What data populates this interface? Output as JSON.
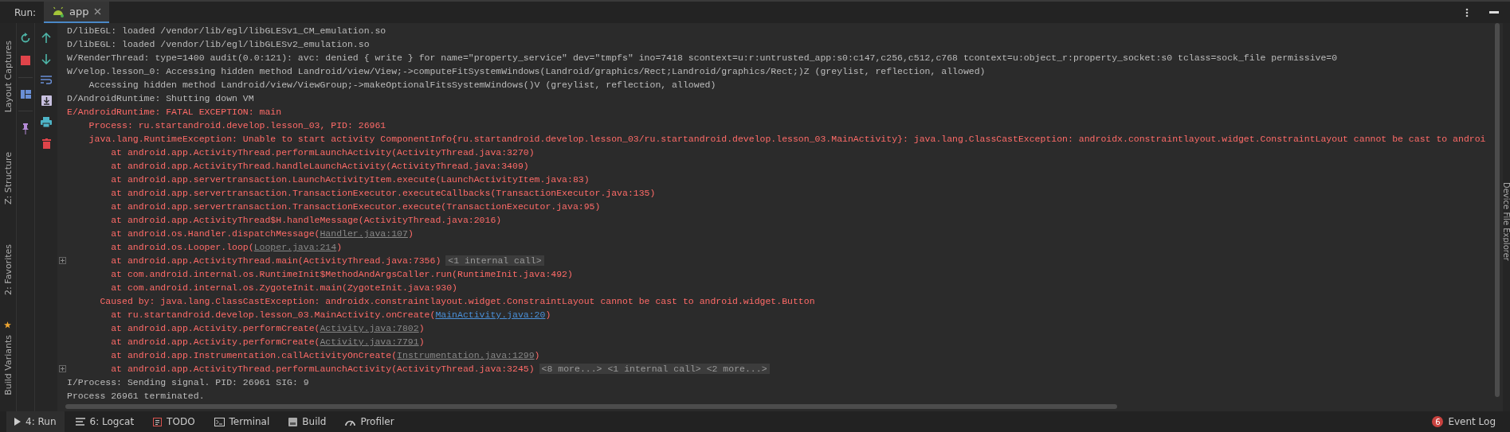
{
  "run_bar": {
    "label": "Run:",
    "tabs": [
      {
        "label": "app",
        "selected": true
      }
    ]
  },
  "left_strip": [
    "Layout Captures",
    "Z: Structure",
    "2: Favorites",
    "Build Variants"
  ],
  "right_strip": [
    "Device File Explorer"
  ],
  "log": [
    {
      "kind": "info",
      "collapsible": false,
      "parts": [
        {
          "kind": "text",
          "text": "D/libEGL: loaded /vendor/lib/egl/libGLESv1_CM_emulation.so"
        }
      ]
    },
    {
      "kind": "info",
      "collapsible": false,
      "parts": [
        {
          "kind": "text",
          "text": "D/libEGL: loaded /vendor/lib/egl/libGLESv2_emulation.so"
        }
      ]
    },
    {
      "kind": "info",
      "collapsible": false,
      "parts": [
        {
          "kind": "text",
          "text": "W/RenderThread: type=1400 audit(0.0:121): avc: denied { write } for name=\"property_service\" dev=\"tmpfs\" ino=7418 scontext=u:r:untrusted_app:s0:c147,c256,c512,c768 tcontext=u:object_r:property_socket:s0 tclass=sock_file permissive=0"
        }
      ]
    },
    {
      "kind": "info",
      "collapsible": false,
      "parts": [
        {
          "kind": "text",
          "text": "W/velop.lesson_0: Accessing hidden method Landroid/view/View;->computeFitSystemWindows(Landroid/graphics/Rect;Landroid/graphics/Rect;)Z (greylist, reflection, allowed)"
        }
      ]
    },
    {
      "kind": "info",
      "collapsible": false,
      "parts": [
        {
          "kind": "text",
          "text": "    Accessing hidden method Landroid/view/ViewGroup;->makeOptionalFitsSystemWindows()V (greylist, reflection, allowed)"
        }
      ]
    },
    {
      "kind": "info",
      "collapsible": false,
      "parts": [
        {
          "kind": "text",
          "text": "D/AndroidRuntime: Shutting down VM"
        }
      ]
    },
    {
      "kind": "error",
      "collapsible": false,
      "parts": [
        {
          "kind": "text",
          "text": "E/AndroidRuntime: FATAL EXCEPTION: main"
        }
      ]
    },
    {
      "kind": "error",
      "collapsible": false,
      "parts": [
        {
          "kind": "text",
          "text": "    Process: ru.startandroid.develop.lesson_03, PID: 26961"
        }
      ]
    },
    {
      "kind": "error",
      "collapsible": false,
      "parts": [
        {
          "kind": "text",
          "text": "    java.lang.RuntimeException: Unable to start activity ComponentInfo{ru.startandroid.develop.lesson_03/ru.startandroid.develop.lesson_03.MainActivity}: java.lang.ClassCastException: androidx.constraintlayout.widget.ConstraintLayout cannot be cast to androi"
        }
      ]
    },
    {
      "kind": "error",
      "collapsible": false,
      "parts": [
        {
          "kind": "text",
          "text": "        at android.app.ActivityThread.performLaunchActivity(ActivityThread.java:3270)"
        }
      ]
    },
    {
      "kind": "error",
      "collapsible": false,
      "parts": [
        {
          "kind": "text",
          "text": "        at android.app.ActivityThread.handleLaunchActivity(ActivityThread.java:3409)"
        }
      ]
    },
    {
      "kind": "error",
      "collapsible": false,
      "parts": [
        {
          "kind": "text",
          "text": "        at android.app.servertransaction.LaunchActivityItem.execute(LaunchActivityItem.java:83)"
        }
      ]
    },
    {
      "kind": "error",
      "collapsible": false,
      "parts": [
        {
          "kind": "text",
          "text": "        at android.app.servertransaction.TransactionExecutor.executeCallbacks(TransactionExecutor.java:135)"
        }
      ]
    },
    {
      "kind": "error",
      "collapsible": false,
      "parts": [
        {
          "kind": "text",
          "text": "        at android.app.servertransaction.TransactionExecutor.execute(TransactionExecutor.java:95)"
        }
      ]
    },
    {
      "kind": "error",
      "collapsible": false,
      "parts": [
        {
          "kind": "text",
          "text": "        at android.app.ActivityThread$H.handleMessage(ActivityThread.java:2016)"
        }
      ]
    },
    {
      "kind": "error",
      "collapsible": false,
      "parts": [
        {
          "kind": "text",
          "text": "        at android.os.Handler.dispatchMessage("
        },
        {
          "kind": "library_link",
          "text": "Handler.java:107"
        },
        {
          "kind": "text",
          "text": ")"
        }
      ]
    },
    {
      "kind": "error",
      "collapsible": false,
      "parts": [
        {
          "kind": "text",
          "text": "        at android.os.Looper.loop("
        },
        {
          "kind": "library_link",
          "text": "Looper.java:214"
        },
        {
          "kind": "text",
          "text": ")"
        }
      ]
    },
    {
      "kind": "error",
      "collapsible": true,
      "parts": [
        {
          "kind": "text",
          "text": "        at android.app.ActivityThread.main(ActivityThread.java:7356)"
        },
        {
          "kind": "folded",
          "text": "<1 internal call>"
        }
      ]
    },
    {
      "kind": "error",
      "collapsible": false,
      "parts": [
        {
          "kind": "text",
          "text": "        at com.android.internal.os.RuntimeInit$MethodAndArgsCaller.run(RuntimeInit.java:492)"
        }
      ]
    },
    {
      "kind": "error",
      "collapsible": false,
      "parts": [
        {
          "kind": "text",
          "text": "        at com.android.internal.os.ZygoteInit.main(ZygoteInit.java:930)"
        }
      ]
    },
    {
      "kind": "error",
      "collapsible": false,
      "parts": [
        {
          "kind": "text",
          "text": "      Caused by: java.lang.ClassCastException: androidx.constraintlayout.widget.ConstraintLayout cannot be cast to android.widget.Button"
        }
      ]
    },
    {
      "kind": "error",
      "collapsible": false,
      "parts": [
        {
          "kind": "text",
          "text": "        at ru.startandroid.develop.lesson_03.MainActivity.onCreate("
        },
        {
          "kind": "project_link",
          "text": "MainActivity.java:20"
        },
        {
          "kind": "text",
          "text": ")"
        }
      ]
    },
    {
      "kind": "error",
      "collapsible": false,
      "parts": [
        {
          "kind": "text",
          "text": "        at android.app.Activity.performCreate("
        },
        {
          "kind": "library_link",
          "text": "Activity.java:7802"
        },
        {
          "kind": "text",
          "text": ")"
        }
      ]
    },
    {
      "kind": "error",
      "collapsible": false,
      "parts": [
        {
          "kind": "text",
          "text": "        at android.app.Activity.performCreate("
        },
        {
          "kind": "library_link",
          "text": "Activity.java:7791"
        },
        {
          "kind": "text",
          "text": ")"
        }
      ]
    },
    {
      "kind": "error",
      "collapsible": false,
      "parts": [
        {
          "kind": "text",
          "text": "        at android.app.Instrumentation.callActivityOnCreate("
        },
        {
          "kind": "library_link",
          "text": "Instrumentation.java:1299"
        },
        {
          "kind": "text",
          "text": ")"
        }
      ]
    },
    {
      "kind": "error",
      "collapsible": true,
      "parts": [
        {
          "kind": "text",
          "text": "        at android.app.ActivityThread.performLaunchActivity(ActivityThread.java:3245)"
        },
        {
          "kind": "folded",
          "text": "<8 more...> <1 internal call> <2 more...>"
        }
      ]
    },
    {
      "kind": "info",
      "collapsible": false,
      "parts": [
        {
          "kind": "text",
          "text": "I/Process: Sending signal. PID: 26961 SIG: 9"
        }
      ]
    },
    {
      "kind": "info",
      "collapsible": false,
      "parts": [
        {
          "kind": "text",
          "text": "Process 26961 terminated."
        }
      ]
    }
  ],
  "bottom_tabs": [
    {
      "label": "4: Run",
      "selected": true
    },
    {
      "label": "6: Logcat",
      "selected": false
    },
    {
      "label": "TODO",
      "selected": false
    },
    {
      "label": "Terminal",
      "selected": false
    },
    {
      "label": "Build",
      "selected": false
    },
    {
      "label": "Profiler",
      "selected": false
    }
  ],
  "event_log": {
    "count": "6",
    "label": "Event Log"
  }
}
